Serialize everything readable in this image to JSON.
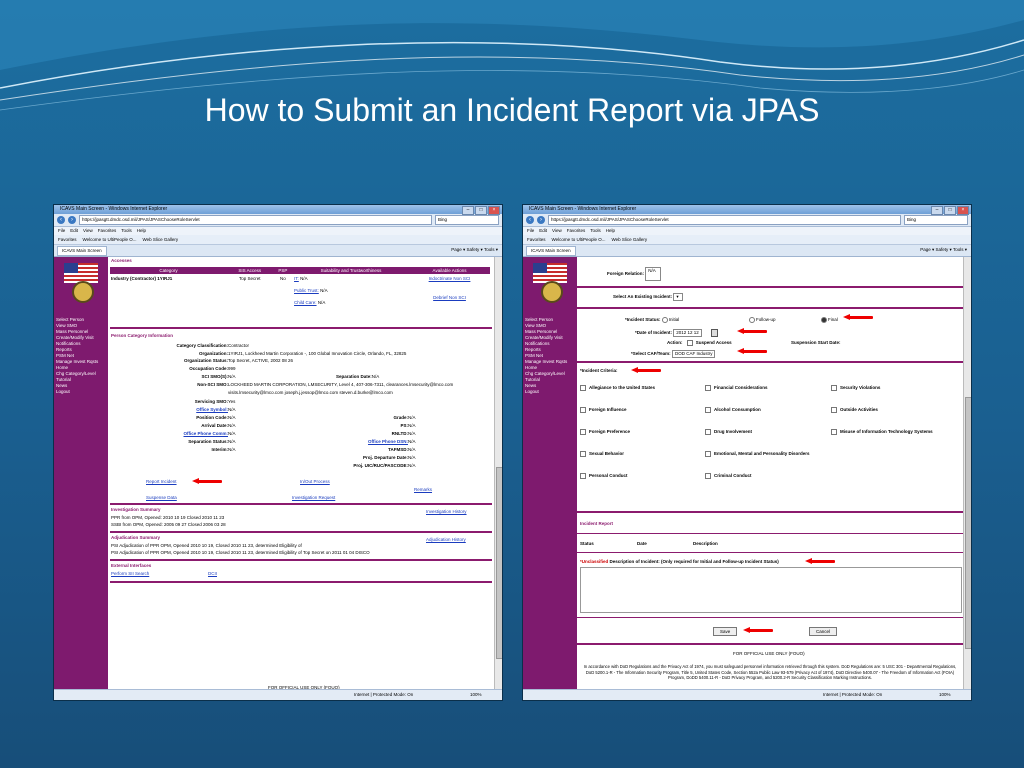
{
  "slide": {
    "title": "How to Submit an Incident Report via JPAS"
  },
  "browser": {
    "window_title": "ICAVS Main Screen - Windows Internet Explorer",
    "url": "https://jpasgtt.dmdc.osd.mil/JPAS/JPASChooseRoleServlet",
    "search": "Bing",
    "menu": [
      "File",
      "Edit",
      "View",
      "Favorites",
      "Tools",
      "Help"
    ],
    "favorites": [
      "Favorites",
      "Welcome to UltiPeople O...",
      "Web Slice Gallery"
    ],
    "tab": "ICAVS Main Screen",
    "tools": "Page ▾  Safety ▾  Tools ▾",
    "status": "Internet | Protected Mode: On",
    "zoom": "100%"
  },
  "sidenav": [
    "Select Person",
    "View SMO",
    "Mass Personnel",
    "Create/Modify Visit",
    "Notifications",
    "Reports",
    "PSM Net",
    "Manage Invest Rqsts",
    "Home",
    "Chg Category/Level",
    "Tutorial",
    "News",
    "Logout"
  ],
  "left": {
    "accesses_title": "Accesses",
    "acc_headers": [
      "Category",
      "SIS Access",
      "PSP",
      "Suitability and Trustworthiness",
      "Available Actions"
    ],
    "acc_row": {
      "category": "Industry (Contractor) 1YIRJ1",
      "sis": "Top Secret",
      "psp": "No",
      "it": "IT: N/A",
      "it_label": "IT:",
      "it_val": "N/A",
      "pt_label": "Public Trust:",
      "pt_val": "N/A",
      "cc_label": "Child Care:",
      "cc_val": "N/A",
      "act1": "Indoctrinate Non SCI",
      "act2": "Debrief Non SCI"
    },
    "pci_title": "Person Category Information",
    "fields": [
      {
        "label": "Category Classification:",
        "value": "Contractor"
      },
      {
        "label": "Organization:",
        "value": "1YIRJ1, Lockheed Martin Corporation -, 100 Global Innovation Circle, Orlando, FL, 32825"
      },
      {
        "label": "Organization Status:",
        "value": "Top Secret, ACTIVE, 2002 08 26"
      },
      {
        "label": "Occupation Code:",
        "value": "999"
      },
      {
        "label": "SCI SMO(S):",
        "value": "N/A"
      },
      {
        "label": "Non-SCI SMO:",
        "value": "LOCKHEED MARTIN CORPORATION, LMSECURITY, Level 4, 407-306-7311, clearances.lmsecurity@lmco.com"
      },
      {
        "label": "",
        "value": "visits.lmsecurity@lmco.com joseph.j.jessop@lmco.com steven.d.burke@lmco.com"
      },
      {
        "label": "Servicing SMO:",
        "value": "Yes"
      },
      {
        "label": "Office Symbol:",
        "value": "N/A"
      },
      {
        "label": "Position Code:",
        "value": "N/A"
      },
      {
        "label": "Arrival Date:",
        "value": "N/A"
      },
      {
        "label": "Office Phone Comm:",
        "value": "N/A"
      },
      {
        "label": "Separation Status:",
        "value": "N/A"
      },
      {
        "label": "Interim:",
        "value": "N/A"
      }
    ],
    "sep_date": {
      "label": "Separation Date:",
      "value": "N/A"
    },
    "right_fields": [
      {
        "label": "Grade:",
        "value": "N/A"
      },
      {
        "label": "PS:",
        "value": "N/A"
      },
      {
        "label": "RNLTD:",
        "value": "N/A"
      },
      {
        "label": "Office Phone DSN:",
        "value": "N/A"
      },
      {
        "label": "TAFMSD:",
        "value": "N/A"
      },
      {
        "label": "Proj. Departure Date:",
        "value": "N/A"
      },
      {
        "label": "Proj. UIC/RUC/PASCODE:",
        "value": "N/A"
      }
    ],
    "links": {
      "report_incident": "Report Incident",
      "suspense": "Suspense Data",
      "inout": "In/Out Process",
      "invest_req": "Investigation Request",
      "remarks": "Remarks"
    },
    "inv_title": "Investigation Summary",
    "inv_history": "Investigation History",
    "inv_lines": [
      "PPR from OPM, Opened: 2010 10 19 Closed 2010 11 23",
      "SSBI from OPM, Opened: 2005 09 27 Closed 2006 03 28"
    ],
    "adj_title": "Adjudication Summary",
    "adj_history": "Adjudication History",
    "adj_lines": [
      "PSI Adjudication of PPR OPM, Opened 2010 10 19, Closed 2010 11 23, determined Eligibility of",
      "PSI Adjudication of PPR OPM, Opened 2010 10 19, Closed 2010 11 23, determined Eligibility of Top Secret on 2011 01 04 DISCO"
    ],
    "ext_title": "External Interfaces",
    "ext_links": [
      "Perform SII Search",
      "DCII"
    ],
    "footer": "FOR OFFICIAL USE ONLY (FOUO)"
  },
  "right": {
    "foreign_relation": {
      "label": "Foreign Relation:",
      "value": "N/A"
    },
    "select_existing": "Select An Existing Incident:",
    "incident_status": {
      "label": "*Incident Status:",
      "options": [
        "Initial",
        "Follow-up",
        "Final"
      ],
      "selected": "Final"
    },
    "date_of_incident": {
      "label": "*Date of Incident:",
      "value": "2012 12 12"
    },
    "action": {
      "label": "Action:",
      "option": "Suspend Access"
    },
    "suspension_start": "Suspension Start Date:",
    "caf_team": {
      "label": "*Select CAF/Team:",
      "value": "DOD CAF Industry"
    },
    "criteria_title": "*Incident Criteria:",
    "criteria": [
      [
        "Allegiance to the United States",
        "Financial Considerations",
        "Security Violations"
      ],
      [
        "Foreign Influence",
        "Alcohol Consumption",
        "Outside Activities"
      ],
      [
        "Foreign Preference",
        "Drug Involvement",
        "Misuse of Information Technology Systems"
      ],
      [
        "Sexual Behavior",
        "Emotional, Mental and Personality Disorders",
        ""
      ],
      [
        "Personal Conduct",
        "Criminal Conduct",
        ""
      ]
    ],
    "report_title": "Incident Report",
    "report_cols": [
      "Status",
      "Date",
      "Description"
    ],
    "unclassified": "*Unclassified",
    "desc_label": "Description of Incident: (Only required for Initial and Follow-up Incident Status)",
    "save": "Save",
    "cancel": "Cancel",
    "fouo": "FOR OFFICIAL USE ONLY (FOUO)",
    "notice": "In accordance with DoD Regulations and the Privacy Act of 1974, you must safeguard personnel information retrieved through this system. DoD Regulations are: 5 USC 301 - Departmental Regulations, DoD 5200.1-R - The Information Security Program, Title 5, United States Code, Section 552a Public Law 93-579 (Privacy Act of 1974), DoD Directive 5400.07 - The Freedom of Information Act (FOIA) Program, DoDD 5400.11-R - DoD Privacy Program, and 5200.2-R Security Classification Marking Instructions."
  },
  "colors": {
    "nav": "#7e1a6e",
    "arrow": "#e00000",
    "bg": "#1a5f90"
  }
}
